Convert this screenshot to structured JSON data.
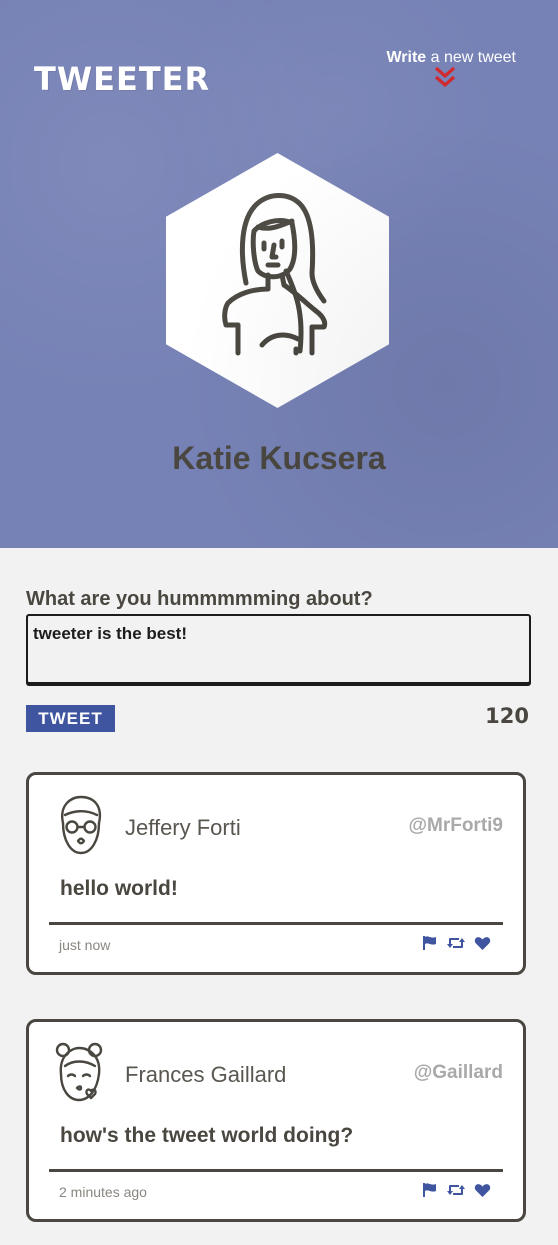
{
  "header": {
    "logo": "TWEETER",
    "write_bold": "Write",
    "write_rest": " a new tweet",
    "profile_name": "Katie Kucsera"
  },
  "compose": {
    "label": "What are you hummmmming about?",
    "value": "tweeter is the best!",
    "button_label": "TWEET",
    "counter": "120"
  },
  "tweets": [
    {
      "name": "Jeffery Forti",
      "handle": "@MrForti9",
      "text": "hello world!",
      "time": "just now"
    },
    {
      "name": "Frances Gaillard",
      "handle": "@Gaillard",
      "text": "how's the tweet world doing?",
      "time": "2 minutes ago"
    }
  ],
  "icons": {
    "flag": "flag-icon",
    "retweet": "retweet-icon",
    "like": "heart-icon"
  },
  "colors": {
    "header_bg": "#7681b5",
    "accent": "#3f55a0",
    "chevron": "#d0262a",
    "text_dark": "#4a4740"
  }
}
